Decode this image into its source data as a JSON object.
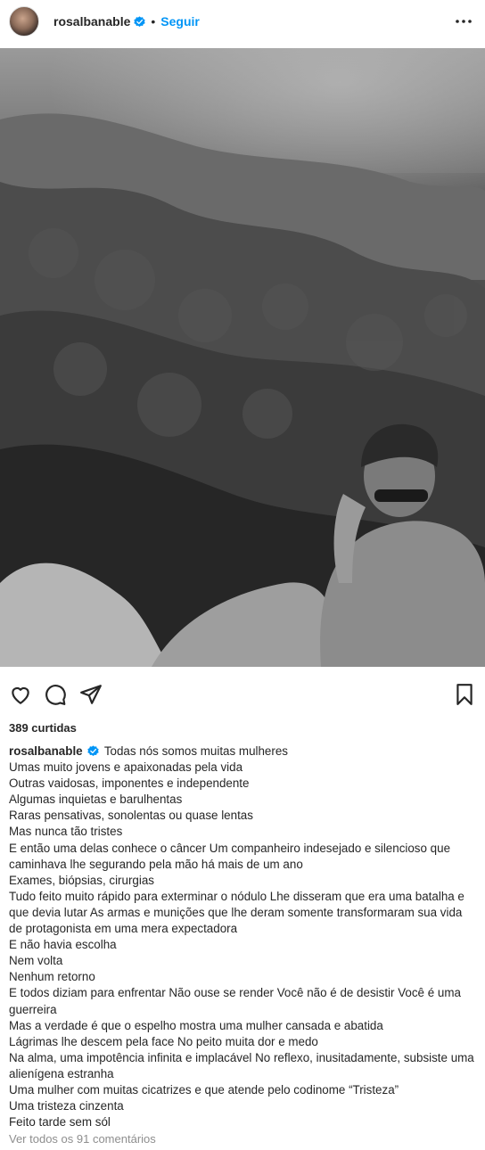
{
  "header": {
    "username": "rosalbanable",
    "separator": "•",
    "follow_label": "Seguir",
    "avatar_icon": "user-avatar",
    "verified_icon": "verified-badge-icon",
    "more_icon": "more-options-icon"
  },
  "photo": {
    "description_icon": "post-photo"
  },
  "actions": {
    "like_icon": "heart-icon",
    "comment_icon": "comment-icon",
    "share_icon": "send-icon",
    "save_icon": "bookmark-icon"
  },
  "likes_text": "389 curtidas",
  "caption": {
    "username": "rosalbanable",
    "lines": [
      "Todas nós somos muitas mulheres",
      "Umas muito jovens e apaixonadas pela vida",
      "Outras vaidosas, imponentes e independente",
      "Algumas inquietas e barulhentas",
      "Raras pensativas, sonolentas ou quase lentas",
      "Mas nunca tão tristes",
      "E então uma delas conhece o câncer Um companheiro indesejado e silencioso que caminhava lhe segurando pela mão há mais de um ano",
      "Exames, biópsias, cirurgias",
      "Tudo feito muito rápido para exterminar o nódulo  Lhe disseram que era uma batalha e que devia lutar As armas e munições que lhe deram somente transformaram sua vida de protagonista em uma mera expectadora",
      "E não havia escolha",
      "Nem volta",
      "Nenhum retorno",
      "E todos diziam para enfrentar Não ouse se render Você não é de desistir Você é uma guerreira",
      "Mas a verdade é que o espelho mostra uma mulher cansada e abatida",
      "Lágrimas lhe descem pela face No peito muita dor e medo",
      "Na alma, uma impotência infinita e implacável  No reflexo, inusitadamente, subsiste uma alienígena estranha",
      "Uma mulher com muitas cicatrizes e que atende pelo codinome “Tristeza”",
      "Uma tristeza cinzenta",
      "Feito tarde sem sól"
    ]
  },
  "comments_link": "Ver todos os 91 comentários",
  "colors": {
    "accent": "#0095f6",
    "verified": "#0095f6",
    "text": "#262626",
    "muted": "#8e8e8e"
  }
}
